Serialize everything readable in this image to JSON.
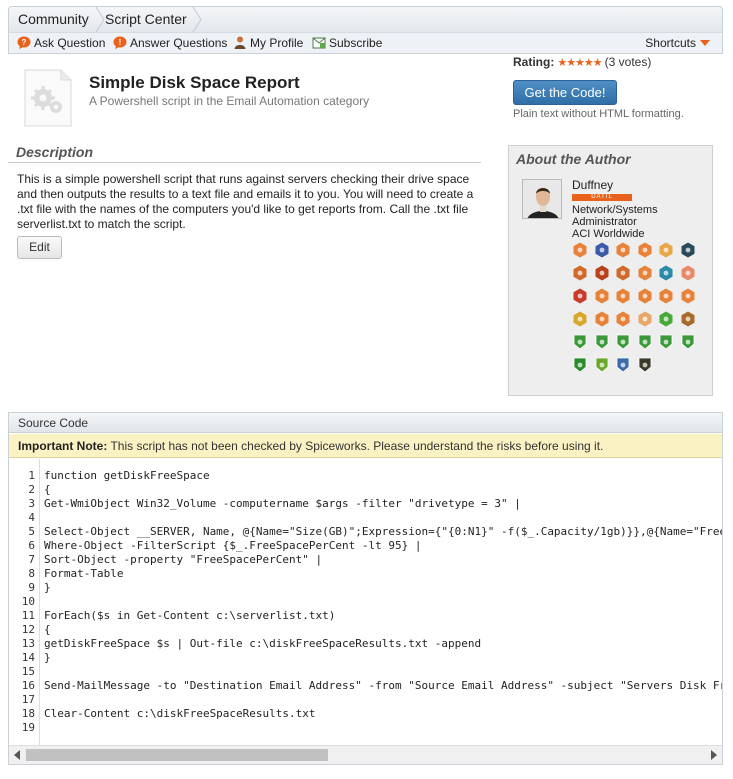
{
  "breadcrumb": [
    "Community",
    "Script Center"
  ],
  "actions": [
    {
      "label": "Ask Question",
      "icon": "ask-question-icon"
    },
    {
      "label": "Answer Questions",
      "icon": "answer-questions-icon"
    },
    {
      "label": "My Profile",
      "icon": "profile-icon"
    },
    {
      "label": "Subscribe",
      "icon": "subscribe-icon"
    }
  ],
  "shortcuts_label": "Shortcuts",
  "script": {
    "title": "Simple Disk Space Report",
    "subtitle": "A Powershell script in the Email Automation category"
  },
  "rating": {
    "label": "Rating:",
    "stars": "★★★★★",
    "votes": "(3 votes)",
    "value_out_of_5": 5
  },
  "get_code_label": "Get the Code!",
  "plain_text_note": "Plain text without HTML formatting.",
  "description": {
    "heading": "Description",
    "body": "This is a simple powershell script that runs against servers checking their drive space and then outputs the results to a text file and emails it to you. You will need to create a .txt file with the names of the computers you'd like to get reports from. Call the .txt file serverlist.txt to match the script.",
    "edit_label": "Edit"
  },
  "author": {
    "heading": "About the Author",
    "name": "Duffney",
    "rank": "DATIL",
    "job": [
      "Network/Systems",
      "Administrator",
      "ACI Worldwide"
    ],
    "badge_colors": [
      "#e8823a",
      "#3b5aa8",
      "#e8823a",
      "#e8823a",
      "#e8a84a",
      "#2a4a5a",
      "#d06a2a",
      "#b8401a",
      "#d06a2a",
      "#e8823a",
      "#2a8aa8",
      "#e88a6a",
      "#c83a2a",
      "#e8823a",
      "#e8823a",
      "#e8823a",
      "#e8823a",
      "#e8823a",
      "#d8a82a",
      "#e8823a",
      "#e8823a",
      "#e8a86a",
      "#4aa83a",
      "#a86a2a",
      "#3a9a3a",
      "#3a9a3a",
      "#3a9a3a",
      "#3a9a3a",
      "#3a9a3a",
      "#3a9a3a",
      "#2a8a2a",
      "#6aa82a",
      "#3a6aa8",
      "#3a3a2a"
    ]
  },
  "source": {
    "heading": "Source Code",
    "note_bold": "Important Note:",
    "note_text": " This script has not been checked by Spiceworks. Please understand the risks before using it.",
    "lines": [
      "function getDiskFreeSpace",
      "{",
      "Get-WmiObject Win32_Volume -computername $args -filter \"drivetype = 3\" |",
      "",
      "Select-Object __SERVER, Name, @{Name=\"Size(GB)\";Expression={\"{0:N1}\" -f($_.Capacity/1gb)}},@{Name=\"FreeSpace",
      "Where-Object -FilterScript {$_.FreeSpacePerCent -lt 95} |",
      "Sort-Object -property \"FreeSpacePerCent\" |",
      "Format-Table",
      "}",
      "",
      "ForEach($s in Get-Content c:\\serverlist.txt)",
      "{",
      "getDiskFreeSpace $s | Out-file c:\\diskFreeSpaceResults.txt -append",
      "}",
      "",
      "Send-MailMessage -to \"Destination Email Address\" -from \"Source Email Address\" -subject \"Servers Disk Free",
      "",
      "Clear-Content c:\\diskFreeSpaceResults.txt",
      ""
    ],
    "scroll_position": 0
  }
}
